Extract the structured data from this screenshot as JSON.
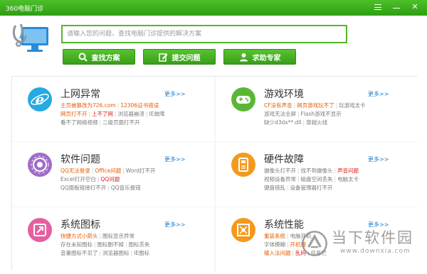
{
  "window": {
    "title": "360电脑门诊"
  },
  "search": {
    "placeholder": "请输入您的问题，查找电脑门诊提供的解决方案",
    "value": ""
  },
  "buttons": {
    "find": "查找方案",
    "submit": "提交问题",
    "help": "求助专家"
  },
  "categories": [
    {
      "title": "上网异常",
      "more": "更多>>",
      "icon": "ie-icon",
      "color": "#27a9e1",
      "rows": [
        [
          {
            "t": "主页被篡改为726.com",
            "s": "hot"
          },
          {
            "t": "12306证书错误",
            "s": "hot"
          }
        ],
        [
          {
            "t": "网页打不开",
            "s": "hot"
          },
          {
            "t": "上不了网",
            "s": "red"
          },
          {
            "t": "浏览器崩溃",
            "s": ""
          },
          {
            "t": "IE故障",
            "s": ""
          }
        ],
        [
          {
            "t": "看不了网络视频",
            "s": ""
          },
          {
            "t": "二级页面打不开",
            "s": ""
          }
        ]
      ]
    },
    {
      "title": "游戏环境",
      "more": "更多>>",
      "icon": "gamepad-icon",
      "color": "#5bb733",
      "rows": [
        [
          {
            "t": "CF没有声音",
            "s": "hot"
          },
          {
            "t": "网页游戏玩不了",
            "s": "hot"
          },
          {
            "t": "玩游戏太卡",
            "s": ""
          }
        ],
        [
          {
            "t": "游戏无法全屏",
            "s": ""
          },
          {
            "t": "Flash游戏不显示",
            "s": ""
          }
        ],
        [
          {
            "t": "缺少d3dx**.dll",
            "s": ""
          },
          {
            "t": "穿越火线",
            "s": ""
          }
        ]
      ]
    },
    {
      "title": "软件问题",
      "more": "更多>>",
      "icon": "software-icon",
      "color": "#a06bc8",
      "rows": [
        [
          {
            "t": "QQ无法登录",
            "s": "hot"
          },
          {
            "t": "Office问题",
            "s": "hot"
          },
          {
            "t": "Word打不开",
            "s": ""
          }
        ],
        [
          {
            "t": "Excel打开空白",
            "s": ""
          },
          {
            "t": "QQ问题",
            "s": "red"
          }
        ],
        [
          {
            "t": "QQ面板链接打不开",
            "s": ""
          },
          {
            "t": "QQ音乐报错",
            "s": ""
          }
        ]
      ]
    },
    {
      "title": "硬件故障",
      "more": "更多>>",
      "icon": "hardware-icon",
      "color": "#f39a1e",
      "rows": [
        [
          {
            "t": "摄像头打不开",
            "s": ""
          },
          {
            "t": "找不到摄像头",
            "s": ""
          },
          {
            "t": "声音问题",
            "s": "red"
          }
        ],
        [
          {
            "t": "视频设备异常",
            "s": ""
          },
          {
            "t": "磁盘空间丢失",
            "s": ""
          },
          {
            "t": "电脑太卡",
            "s": ""
          }
        ],
        [
          {
            "t": "键盘错乱",
            "s": ""
          },
          {
            "t": "设备管理器打不开",
            "s": ""
          }
        ]
      ]
    },
    {
      "title": "系统图标",
      "more": "更多>>",
      "icon": "system-icons-icon",
      "color": "#e55fa0",
      "rows": [
        [
          {
            "t": "快捷方式小箭头",
            "s": "hot"
          },
          {
            "t": "图标显示异常",
            "s": ""
          }
        ],
        [
          {
            "t": "存在未知图标",
            "s": ""
          },
          {
            "t": "图标删不掉",
            "s": ""
          },
          {
            "t": "图标丢失",
            "s": ""
          }
        ],
        [
          {
            "t": "音量图标不见了",
            "s": ""
          },
          {
            "t": "浏览器图标",
            "s": ""
          },
          {
            "t": "IE图标",
            "s": ""
          }
        ]
      ]
    },
    {
      "title": "系统性能",
      "more": "更多>>",
      "icon": "performance-icon",
      "color": "#f39a1e",
      "rows": [
        [
          {
            "t": "重装系统",
            "s": "hot"
          },
          {
            "t": "电脑开机",
            "s": ""
          }
        ],
        [
          {
            "t": "字体模糊",
            "s": ""
          },
          {
            "t": "开机慢",
            "s": "hot"
          }
        ],
        [
          {
            "t": "输入法问题",
            "s": "hot"
          },
          {
            "t": "乱码",
            "s": "red"
          },
          {
            "t": "任务栏",
            "s": ""
          }
        ]
      ]
    }
  ],
  "watermark": {
    "text_cn": "当下软件园",
    "text_en": "www.downxia.com"
  }
}
